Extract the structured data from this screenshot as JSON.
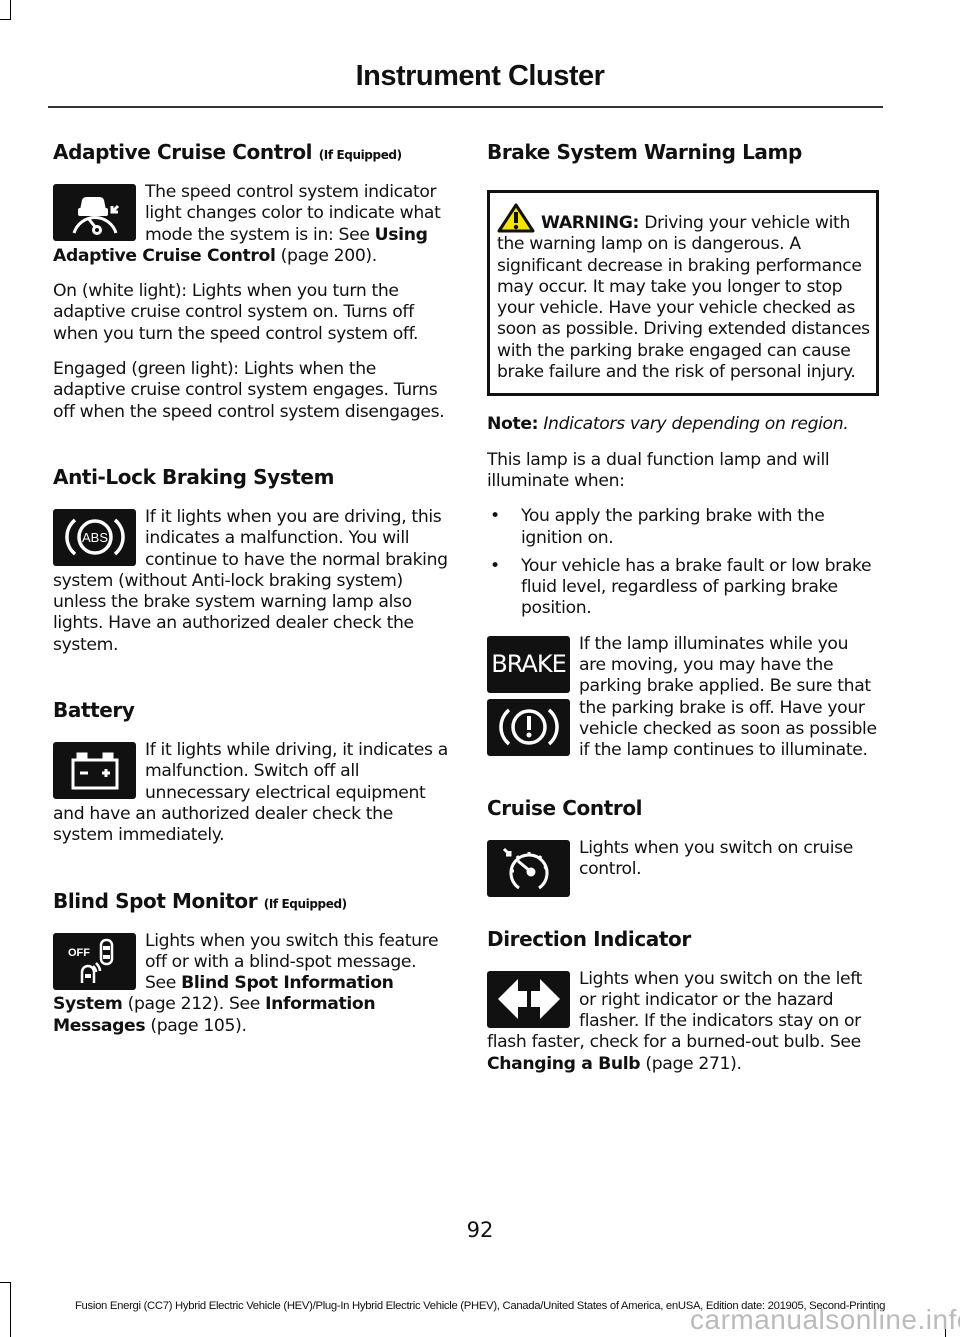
{
  "header": {
    "title": "Instrument Cluster"
  },
  "left_column": {
    "acc": {
      "heading": "Adaptive Cruise Control",
      "heading_suffix": "(If Equipped)",
      "icon": "adaptive-cruise-control-icon",
      "p1_text": "The speed control system indicator light changes color to indicate what mode the system is in: See ",
      "p1_link": "Using Adaptive Cruise Control",
      "p1_ref": " (page 200).",
      "p2": "On (white light): Lights when you turn the adaptive cruise control system on. Turns off when you turn the speed control system off.",
      "p3": "Engaged (green light): Lights when the adaptive cruise control system engages. Turns off when the speed control system disengages."
    },
    "abs": {
      "heading": "Anti-Lock Braking System",
      "icon": "abs-icon",
      "icon_label": "ABS",
      "p1": "If it lights when you are driving, this indicates a malfunction. You will continue to have the normal braking system (without Anti-lock braking system) unless the brake system warning lamp also lights. Have an authorized dealer check the system."
    },
    "battery": {
      "heading": "Battery",
      "icon": "battery-icon",
      "p1": "If it lights while driving, it indicates a malfunction. Switch off all unnecessary electrical equipment and have an authorized dealer check the system immediately."
    },
    "bsm": {
      "heading": "Blind Spot Monitor",
      "heading_suffix": "(If Equipped)",
      "icon": "blind-spot-off-icon",
      "icon_label": "OFF",
      "p1_text": "Lights when you switch this feature off or with a blind-spot message.  See ",
      "p1_link1": "Blind Spot Information System",
      "p1_ref1": " (page 212).   See ",
      "p1_link2": "Information Messages",
      "p1_ref2": " (page 105)."
    }
  },
  "right_column": {
    "brake": {
      "heading": "Brake System Warning Lamp",
      "warning_label": "WARNING:",
      "warning_text": " Driving your vehicle with the warning lamp on is dangerous. A significant decrease in braking performance may occur. It may take you longer to stop your vehicle. Have your vehicle checked as soon as possible. Driving extended distances with the parking brake engaged can cause brake failure and the risk of personal injury.",
      "note_label": "Note:",
      "note_text": " Indicators vary depending on region.",
      "p1": "This lamp is a dual function lamp and will illuminate when:",
      "bullets": [
        "You apply the parking brake with the ignition on.",
        "Your vehicle has a brake fault or low brake fluid level, regardless of parking brake position."
      ],
      "bullet_char": "•",
      "icon1_label": "BRAKE",
      "icon2": "brake-warning-icon",
      "p2": "If the lamp illuminates while you are moving, you may have the parking brake applied. Be sure that the parking brake is off. Have your vehicle checked as soon as possible if the lamp continues to illuminate."
    },
    "cruise": {
      "heading": "Cruise Control",
      "icon": "cruise-control-icon",
      "p1": "Lights when you switch on cruise control."
    },
    "direction": {
      "heading": "Direction Indicator",
      "icon": "direction-indicator-icon",
      "p1_text": "Lights when you switch on the left or right indicator or the hazard flasher. If the indicators stay on or flash faster, check for a burned-out bulb.  See ",
      "p1_link": "Changing a Bulb",
      "p1_ref": " (page 271)."
    }
  },
  "footer": {
    "page_number": "92",
    "edition_text": "Fusion Energi (CC7) Hybrid Electric Vehicle (HEV)/Plug-In Hybrid Electric Vehicle (PHEV), Canada/United States of America, enUSA, Edition date: 201905, Second-Printing",
    "watermark": "carmanualsonline.info"
  },
  "colors": {
    "warning_yellow": "#f5e400",
    "icon_bg": "#111111"
  }
}
